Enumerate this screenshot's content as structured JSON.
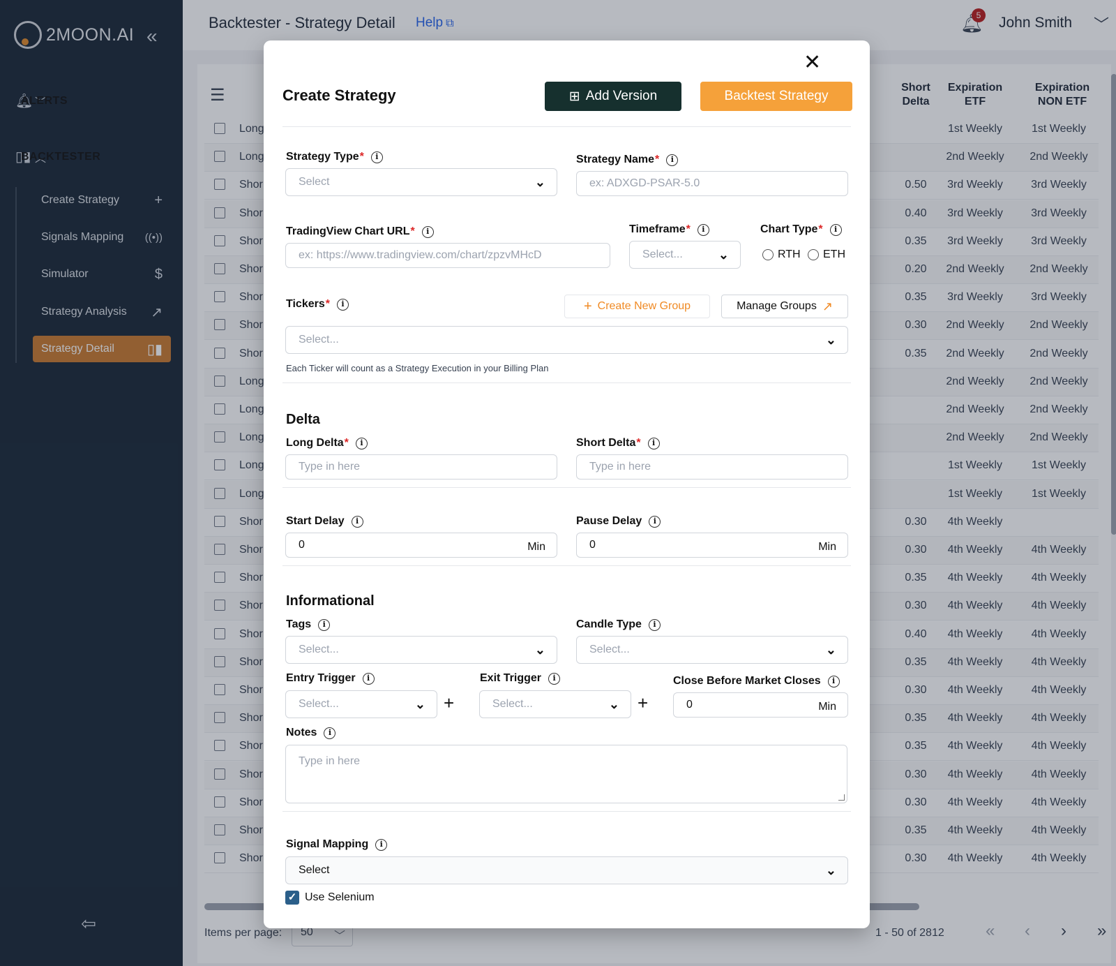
{
  "sidebar": {
    "logo_text": "2MOON.AI",
    "sections": [
      {
        "label": "ALERTS",
        "icon": "bell-icon",
        "expanded": false
      },
      {
        "label": "BACKTESTER",
        "icon": "bar-chart-icon",
        "expanded": true
      }
    ],
    "sub_items": [
      {
        "label": "Create Strategy",
        "icon": "plus-icon",
        "active": false
      },
      {
        "label": "Signals Mapping",
        "icon": "broadcast-icon",
        "active": false
      },
      {
        "label": "Simulator",
        "icon": "dollar-icon",
        "active": false
      },
      {
        "label": "Strategy Analysis",
        "icon": "trend-up-icon",
        "active": false
      },
      {
        "label": "Strategy Detail",
        "icon": "bar-chart-icon",
        "active": true
      }
    ]
  },
  "header": {
    "title": "Backtester - Strategy Detail",
    "help": "Help",
    "notifications": "5",
    "user": "John Smith"
  },
  "table": {
    "columns": [
      "Short Delta",
      "Expiration ETF",
      "Expiration NON ETF"
    ],
    "columns_split": [
      [
        "Short",
        "Delta"
      ],
      [
        "Expiration",
        "ETF"
      ],
      [
        "Expiration",
        "NON ETF"
      ]
    ],
    "rows": [
      {
        "side": "Long",
        "short_delta": "",
        "etf": "1st Weekly",
        "non_etf": "1st Weekly"
      },
      {
        "side": "Long",
        "short_delta": "",
        "etf": "2nd Weekly",
        "non_etf": "2nd Weekly"
      },
      {
        "side": "Shor",
        "short_delta": "0.50",
        "etf": "3rd Weekly",
        "non_etf": "3rd Weekly"
      },
      {
        "side": "Shor",
        "short_delta": "0.40",
        "etf": "3rd Weekly",
        "non_etf": "3rd Weekly"
      },
      {
        "side": "Shor",
        "short_delta": "0.35",
        "etf": "3rd Weekly",
        "non_etf": "3rd Weekly"
      },
      {
        "side": "Shor",
        "short_delta": "0.20",
        "etf": "2nd Weekly",
        "non_etf": "2nd Weekly"
      },
      {
        "side": "Shor",
        "short_delta": "0.35",
        "etf": "3rd Weekly",
        "non_etf": "3rd Weekly"
      },
      {
        "side": "Shor",
        "short_delta": "0.30",
        "etf": "2nd Weekly",
        "non_etf": "2nd Weekly"
      },
      {
        "side": "Shor",
        "short_delta": "0.35",
        "etf": "2nd Weekly",
        "non_etf": "2nd Weekly"
      },
      {
        "side": "Long",
        "short_delta": "",
        "etf": "2nd Weekly",
        "non_etf": "2nd Weekly"
      },
      {
        "side": "Long",
        "short_delta": "",
        "etf": "2nd Weekly",
        "non_etf": "2nd Weekly"
      },
      {
        "side": "Long",
        "short_delta": "",
        "etf": "2nd Weekly",
        "non_etf": "2nd Weekly"
      },
      {
        "side": "Long",
        "short_delta": "",
        "etf": "1st Weekly",
        "non_etf": "1st Weekly"
      },
      {
        "side": "Long",
        "short_delta": "",
        "etf": "1st Weekly",
        "non_etf": "1st Weekly"
      },
      {
        "side": "Shor",
        "short_delta": "0.30",
        "etf": "4th Weekly",
        "non_etf": ""
      },
      {
        "side": "Shor",
        "short_delta": "0.30",
        "etf": "4th Weekly",
        "non_etf": "4th Weekly"
      },
      {
        "side": "Shor",
        "short_delta": "0.35",
        "etf": "4th Weekly",
        "non_etf": "4th Weekly"
      },
      {
        "side": "Shor",
        "short_delta": "0.30",
        "etf": "4th Weekly",
        "non_etf": "4th Weekly"
      },
      {
        "side": "Shor",
        "short_delta": "0.40",
        "etf": "4th Weekly",
        "non_etf": "4th Weekly"
      },
      {
        "side": "Shor",
        "short_delta": "0.35",
        "etf": "4th Weekly",
        "non_etf": "4th Weekly"
      },
      {
        "side": "Shor",
        "short_delta": "0.30",
        "etf": "4th Weekly",
        "non_etf": "4th Weekly"
      },
      {
        "side": "Shor",
        "short_delta": "0.35",
        "etf": "4th Weekly",
        "non_etf": "4th Weekly"
      },
      {
        "side": "Shor",
        "short_delta": "0.35",
        "etf": "4th Weekly",
        "non_etf": "4th Weekly"
      },
      {
        "side": "Shor",
        "short_delta": "0.30",
        "etf": "4th Weekly",
        "non_etf": "4th Weekly"
      },
      {
        "side": "Shor",
        "short_delta": "0.30",
        "etf": "4th Weekly",
        "non_etf": "4th Weekly"
      },
      {
        "side": "Shor",
        "short_delta": "0.35",
        "etf": "4th Weekly",
        "non_etf": "4th Weekly"
      },
      {
        "side": "Shor",
        "short_delta": "0.30",
        "etf": "4th Weekly",
        "non_etf": "4th Weekly"
      }
    ],
    "pager": {
      "label": "Items per page:",
      "per_page": "50",
      "range": "1 - 50 of 2812"
    }
  },
  "modal": {
    "title": "Create Strategy",
    "add_version": "Add Version",
    "backtest": "Backtest Strategy",
    "strategy_type": {
      "label": "Strategy Type",
      "value": "Select"
    },
    "strategy_name": {
      "label": "Strategy Name",
      "placeholder": "ex: ADXGD-PSAR-5.0"
    },
    "chart_url": {
      "label": "TradingView Chart URL",
      "placeholder": "ex: https://www.tradingview.com/chart/zpzvMHcD"
    },
    "timeframe": {
      "label": "Timeframe",
      "value": "Select..."
    },
    "chart_type": {
      "label": "Chart Type",
      "options": [
        "RTH",
        "ETH"
      ]
    },
    "tickers": {
      "label": "Tickers",
      "value": "Select...",
      "create_group": "Create New Group",
      "manage_groups": "Manage Groups",
      "hint": "Each Ticker will count as a Strategy Execution in your Billing Plan"
    },
    "delta": {
      "title": "Delta",
      "long_label": "Long Delta",
      "short_label": "Short Delta",
      "placeholder": "Type in here"
    },
    "start_delay": {
      "label": "Start Delay",
      "value": "0",
      "unit": "Min"
    },
    "pause_delay": {
      "label": "Pause Delay",
      "value": "0",
      "unit": "Min"
    },
    "informational": {
      "title": "Informational"
    },
    "tags": {
      "label": "Tags",
      "value": "Select..."
    },
    "candle_type": {
      "label": "Candle Type",
      "value": "Select..."
    },
    "entry_trigger": {
      "label": "Entry Trigger",
      "value": "Select..."
    },
    "exit_trigger": {
      "label": "Exit Trigger",
      "value": "Select..."
    },
    "close_before": {
      "label": "Close Before Market Closes",
      "value": "0",
      "unit": "Min"
    },
    "notes": {
      "label": "Notes",
      "placeholder": "Type in here"
    },
    "signal_mapping": {
      "label": "Signal Mapping",
      "value": "Select"
    },
    "use_selenium": {
      "label": "Use Selenium",
      "checked": true
    }
  },
  "colors": {
    "sidebar": "#1a2736",
    "accent": "#c97a2e",
    "orange": "#f5a13a",
    "dark_button": "#16302e"
  }
}
